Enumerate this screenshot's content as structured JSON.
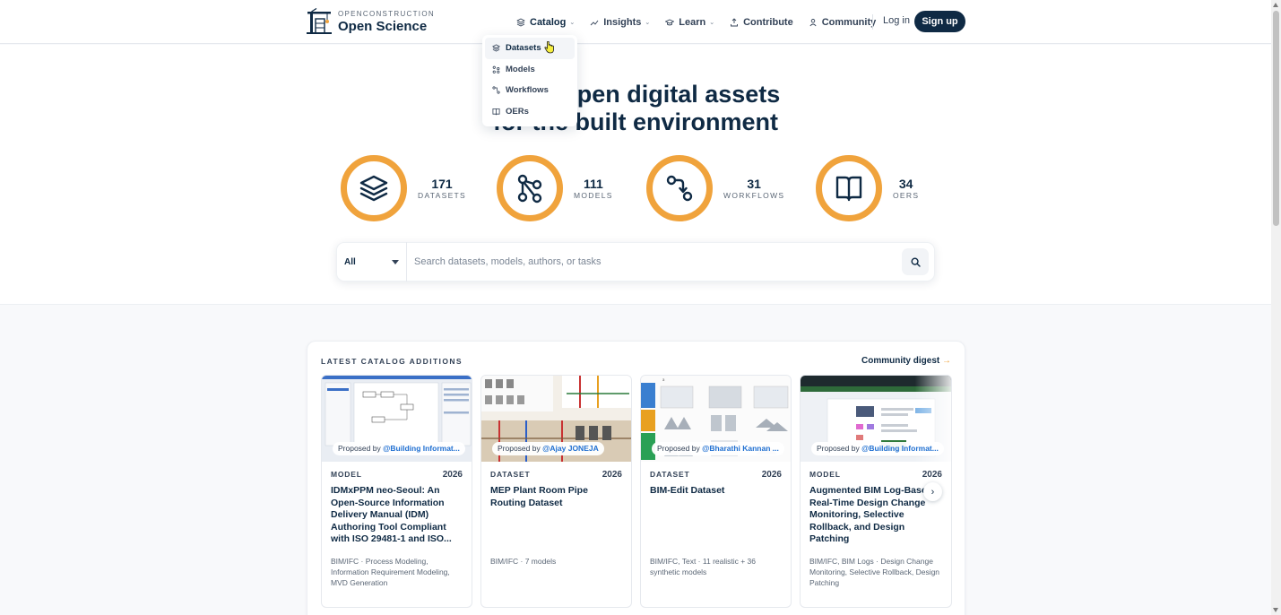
{
  "brand": {
    "small": "OPENCONSTRUCTION",
    "big": "Open Science"
  },
  "nav": {
    "items": [
      {
        "label": "Catalog",
        "icon": "layers-icon",
        "dropdown": true,
        "active": true
      },
      {
        "label": "Insights",
        "icon": "chart-icon",
        "dropdown": true
      },
      {
        "label": "Learn",
        "icon": "graduation-icon",
        "dropdown": true
      },
      {
        "label": "Contribute",
        "icon": "upload-icon",
        "dropdown": false
      },
      {
        "label": "Community",
        "icon": "user-icon",
        "dropdown": false
      }
    ],
    "login": "Log in",
    "signup": "Sign up"
  },
  "catalog_menu": [
    {
      "label": "Datasets",
      "icon": "layers-icon"
    },
    {
      "label": "Models",
      "icon": "nodes-icon"
    },
    {
      "label": "Workflows",
      "icon": "workflow-icon"
    },
    {
      "label": "OERs",
      "icon": "book-icon"
    }
  ],
  "hero": {
    "title_line1": "D        open digital assets",
    "title_line2": "for the built environment"
  },
  "stats": [
    {
      "value": "171",
      "label": "DATASETS",
      "icon": "layers-icon"
    },
    {
      "value": "111",
      "label": "MODELS",
      "icon": "nodes-icon"
    },
    {
      "value": "31",
      "label": "WORKFLOWS",
      "icon": "workflow-icon"
    },
    {
      "value": "34",
      "label": "OERS",
      "icon": "book-icon"
    }
  ],
  "search": {
    "filter_value": "All",
    "placeholder": "Search datasets, models, authors, or tasks"
  },
  "latest": {
    "title": "LATEST CATALOG ADDITIONS",
    "link": "Community digest",
    "link_arrow": "→",
    "proposed_prefix": "Proposed by",
    "cards": [
      {
        "type": "MODEL",
        "year": "2026",
        "author": "@Building Informat...",
        "title": "IDMxPPM neo-Seoul: An Open-Source Information Delivery Manual (IDM) Authoring Tool Compliant with ISO 29481-1 and ISO...",
        "tags": "BIM/IFC · Process Modeling, Information Requirement Modeling, MVD Generation"
      },
      {
        "type": "DATASET",
        "year": "2026",
        "author": "@Ajay JONEJA",
        "title": "MEP Plant Room Pipe Routing Dataset",
        "tags": "BIM/IFC · 7 models"
      },
      {
        "type": "DATASET",
        "year": "2026",
        "author": "@Bharathi Kannan ...",
        "title": "BIM-Edit Dataset",
        "tags": "BIM/IFC, Text · 11 realistic + 36 synthetic models"
      },
      {
        "type": "MODEL",
        "year": "2026",
        "author": "@Building Informat...",
        "title": "Augmented BIM Log-Based Real-Time Design Change Monitoring, Selective Rollback, and Design Patching",
        "tags": "BIM/IFC, BIM Logs · Design Change Monitoring, Selective Rollback, Design Patching"
      }
    ],
    "next_icon": "›"
  },
  "colors": {
    "accent": "#f0a33c",
    "primary": "#0f2a44",
    "link": "#1f6fd1"
  }
}
